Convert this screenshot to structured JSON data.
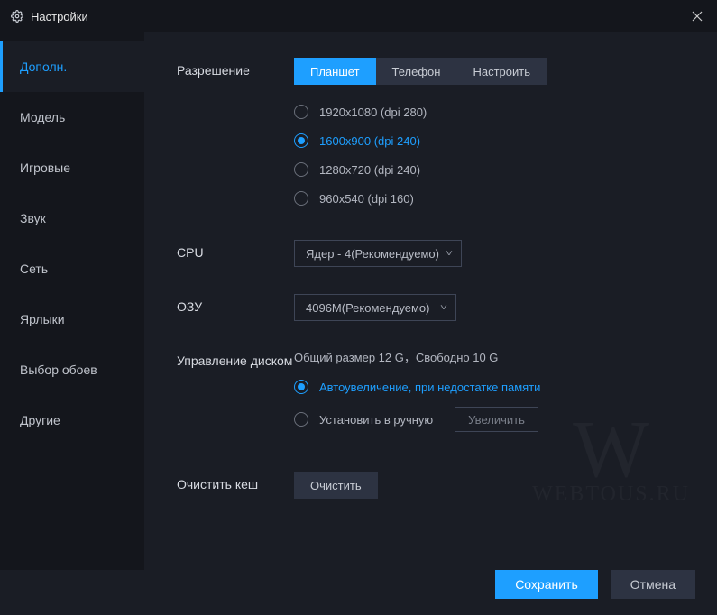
{
  "title": "Настройки",
  "sidebar": {
    "items": [
      {
        "label": "Дополн."
      },
      {
        "label": "Модель"
      },
      {
        "label": "Игровые"
      },
      {
        "label": "Звук"
      },
      {
        "label": "Сеть"
      },
      {
        "label": "Ярлыки"
      },
      {
        "label": "Выбор обоев"
      },
      {
        "label": "Другие"
      }
    ],
    "active": 0
  },
  "sections": {
    "resolution": {
      "label": "Разрешение",
      "tabs": [
        "Планшет",
        "Телефон",
        "Настроить"
      ],
      "active_tab": 0,
      "options": [
        "1920x1080  (dpi 280)",
        "1600x900  (dpi 240)",
        "1280x720  (dpi 240)",
        "960x540  (dpi 160)"
      ],
      "selected": 1
    },
    "cpu": {
      "label": "CPU",
      "value": "Ядер - 4(Рекомендуемо)"
    },
    "ram": {
      "label": "ОЗУ",
      "value": "4096M(Рекомендуемо)"
    },
    "disk": {
      "label": "Управление диском",
      "info": "Общий размер 12 G，Свободно 10 G",
      "auto_label": "Автоувеличение, при недостатке памяти",
      "manual_label": "Установить в ручную",
      "enlarge_btn": "Увеличить",
      "selected": "auto"
    },
    "cache": {
      "label": "Очистить кеш",
      "button": "Очистить"
    }
  },
  "footer": {
    "save": "Сохранить",
    "cancel": "Отмена"
  },
  "watermark": {
    "letter": "W",
    "text": "WEBTOUS.RU"
  }
}
